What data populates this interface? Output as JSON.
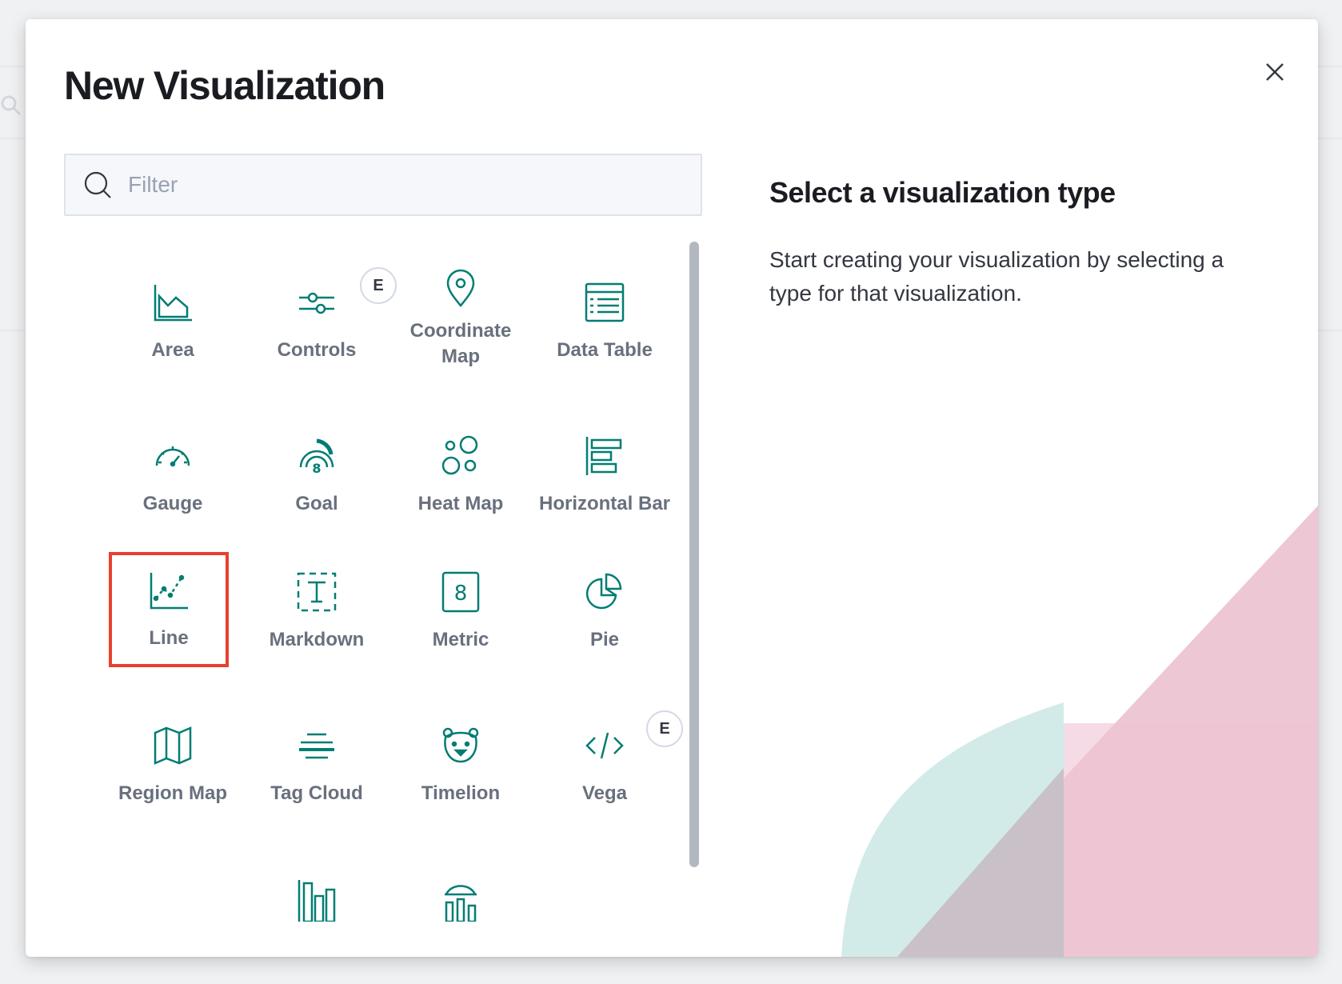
{
  "modal": {
    "title": "New Visualization",
    "close_icon": "close-icon"
  },
  "filter": {
    "placeholder": "Filter",
    "value": "",
    "icon": "search-icon"
  },
  "visualizations": [
    {
      "label": "Area",
      "icon": "area-chart-icon"
    },
    {
      "label": "Controls",
      "icon": "controls-icon",
      "badge": "E"
    },
    {
      "label": "Coordinate Map",
      "icon": "map-pin-icon"
    },
    {
      "label": "Data Table",
      "icon": "data-table-icon"
    },
    {
      "label": "Gauge",
      "icon": "gauge-icon"
    },
    {
      "label": "Goal",
      "icon": "goal-icon"
    },
    {
      "label": "Heat Map",
      "icon": "heatmap-icon"
    },
    {
      "label": "Horizontal Bar",
      "icon": "horizontal-bar-icon"
    },
    {
      "label": "Line",
      "icon": "line-chart-icon",
      "selected": true
    },
    {
      "label": "Markdown",
      "icon": "markdown-icon"
    },
    {
      "label": "Metric",
      "icon": "metric-icon"
    },
    {
      "label": "Pie",
      "icon": "pie-chart-icon"
    },
    {
      "label": "Region Map",
      "icon": "region-map-icon"
    },
    {
      "label": "Tag Cloud",
      "icon": "tag-cloud-icon"
    },
    {
      "label": "Timelion",
      "icon": "timelion-icon"
    },
    {
      "label": "Vega",
      "icon": "vega-icon",
      "badge": "E"
    },
    {
      "label": "",
      "icon": "vertical-bar-icon"
    },
    {
      "label": "",
      "icon": "visual-builder-icon"
    }
  ],
  "description": {
    "title": "Select a visualization type",
    "text": "Start creating your visualization by selecting a type for that visualization."
  },
  "colors": {
    "icon": "#017d73",
    "selection": "#e7412f",
    "decor_pink": "#e8b9c8",
    "decor_teal": "#cbe8e4"
  }
}
